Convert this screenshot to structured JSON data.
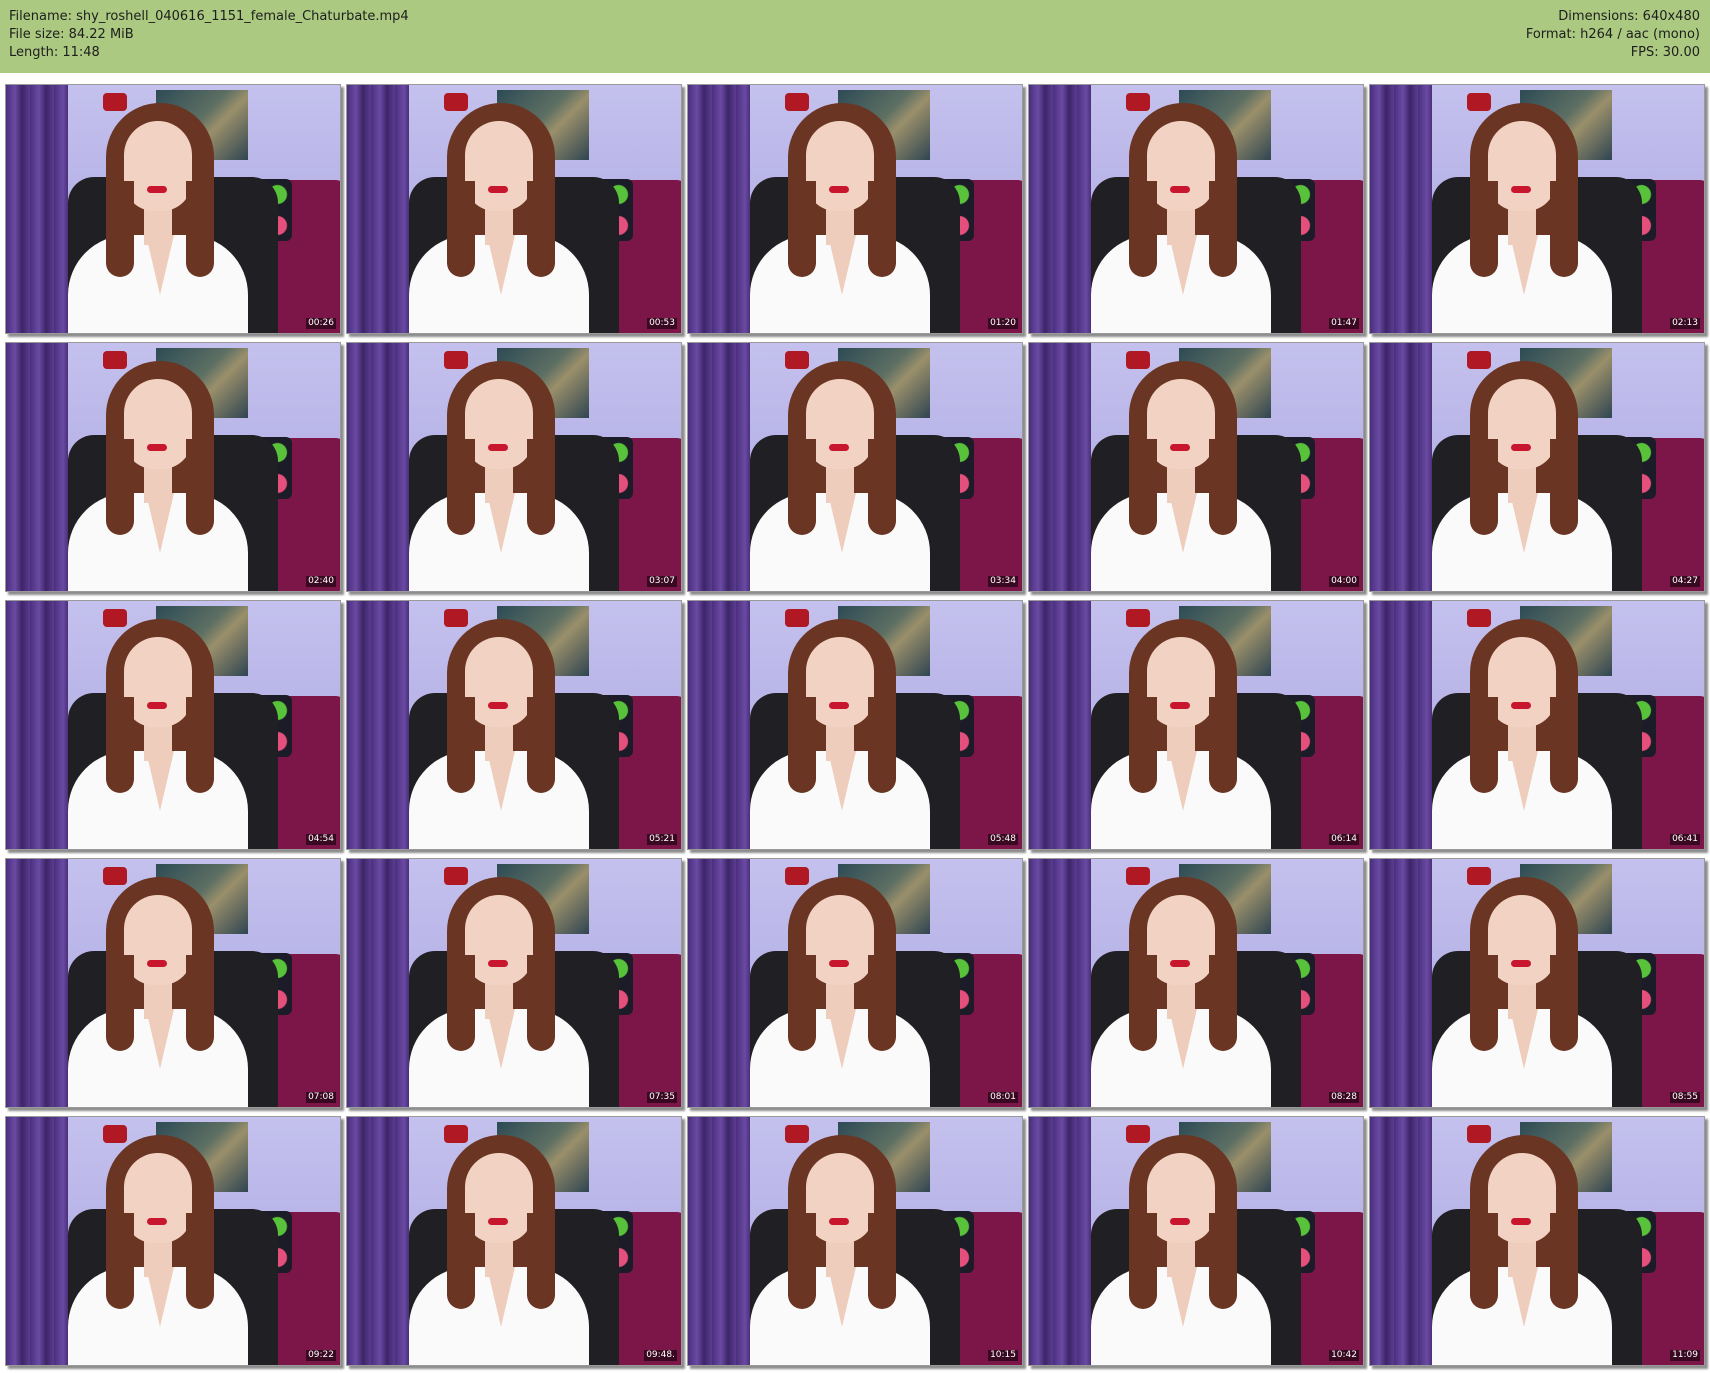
{
  "header": {
    "filename": "Filename: shy_roshell_040616_1151_female_Chaturbate.mp4",
    "filesize": "File size: 84.22 MiB",
    "length": "Length: 11:48",
    "dimensions": "Dimensions: 640x480",
    "format": "Format: h264 / aac (mono)",
    "fps": "FPS: 30.00"
  },
  "colors": {
    "header_bg": "#abc980",
    "page_bg": "#ffffff"
  },
  "thumbnails": [
    {
      "timestamp": "00:26"
    },
    {
      "timestamp": "00:53"
    },
    {
      "timestamp": "01:20"
    },
    {
      "timestamp": "01:47"
    },
    {
      "timestamp": "02:13"
    },
    {
      "timestamp": "02:40"
    },
    {
      "timestamp": "03:07"
    },
    {
      "timestamp": "03:34"
    },
    {
      "timestamp": "04:00"
    },
    {
      "timestamp": "04:27"
    },
    {
      "timestamp": "04:54"
    },
    {
      "timestamp": "05:21"
    },
    {
      "timestamp": "05:48"
    },
    {
      "timestamp": "06:14"
    },
    {
      "timestamp": "06:41"
    },
    {
      "timestamp": "07:08"
    },
    {
      "timestamp": "07:35"
    },
    {
      "timestamp": "08:01"
    },
    {
      "timestamp": "08:28"
    },
    {
      "timestamp": "08:55"
    },
    {
      "timestamp": "09:22"
    },
    {
      "timestamp": "09:48."
    },
    {
      "timestamp": "10:15"
    },
    {
      "timestamp": "10:42"
    },
    {
      "timestamp": "11:09"
    }
  ]
}
